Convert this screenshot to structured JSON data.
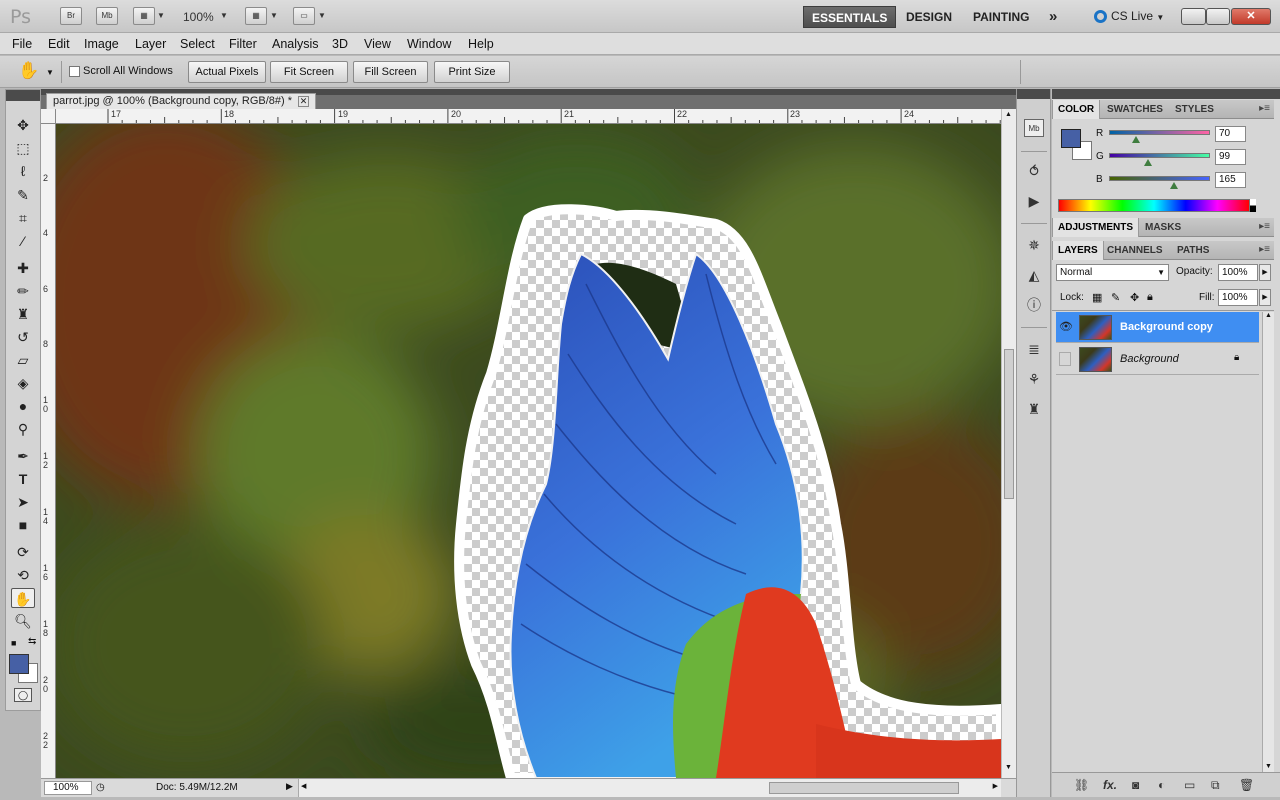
{
  "app": {
    "logo": "Ps",
    "launch_buttons": [
      "Br",
      "Mb"
    ],
    "zoom_level": "100%",
    "workspaces": [
      "ESSENTIALS",
      "DESIGN",
      "PAINTING"
    ],
    "active_workspace": "ESSENTIALS",
    "more_workspaces": "»",
    "cs_live": "CS Live"
  },
  "menu": [
    "File",
    "Edit",
    "Image",
    "Layer",
    "Select",
    "Filter",
    "Analysis",
    "3D",
    "View",
    "Window",
    "Help"
  ],
  "options": {
    "scroll_all_windows": "Scroll All Windows",
    "actual_pixels": "Actual Pixels",
    "fit_screen": "Fit Screen",
    "fill_screen": "Fill Screen",
    "print_size": "Print Size"
  },
  "document": {
    "tab_title": "parrot.jpg @ 100% (Background copy, RGB/8#) *",
    "ruler_top_numbers": [
      "17",
      "18",
      "19",
      "20",
      "21",
      "22",
      "23",
      "24"
    ],
    "ruler_left_numbers": [
      "2",
      "4",
      "6",
      "8",
      "1 0",
      "1 2",
      "1 4",
      "1 6",
      "1 8",
      "2 0",
      "2 2"
    ],
    "status_zoom": "100%",
    "doc_size": "Doc: 5.49M/12.2M"
  },
  "color_panel": {
    "tabs": [
      "COLOR",
      "SWATCHES",
      "STYLES"
    ],
    "active_tab": "COLOR",
    "foreground": "#4660a5",
    "background": "#ffffff",
    "channels": [
      {
        "label": "R",
        "value": "70"
      },
      {
        "label": "G",
        "value": "99"
      },
      {
        "label": "B",
        "value": "165"
      }
    ]
  },
  "adjustments_panel": {
    "tabs": [
      "ADJUSTMENTS",
      "MASKS"
    ],
    "active_tab": "ADJUSTMENTS"
  },
  "layers_panel": {
    "tabs": [
      "LAYERS",
      "CHANNELS",
      "PATHS"
    ],
    "active_tab": "LAYERS",
    "blend_mode": "Normal",
    "opacity_label": "Opacity:",
    "opacity": "100%",
    "lock_label": "Lock:",
    "fill_label": "Fill:",
    "fill": "100%",
    "layers": [
      {
        "name": "Background copy",
        "selected": true,
        "visible": true,
        "locked": false
      },
      {
        "name": "Background",
        "selected": false,
        "visible": false,
        "locked": true
      }
    ]
  },
  "tools": [
    "move-tool",
    "marquee-tool",
    "lasso-tool",
    "quick-selection-tool",
    "crop-tool",
    "eyedropper-tool",
    "spot-healing-tool",
    "brush-tool",
    "clone-stamp-tool",
    "history-brush-tool",
    "eraser-tool",
    "paint-bucket-tool",
    "blur-tool",
    "dodge-tool",
    "pen-tool",
    "type-tool",
    "path-selection-tool",
    "rectangle-tool",
    "3d-rotate-tool",
    "3d-orbit-tool",
    "hand-tool",
    "zoom-tool"
  ],
  "active_tool": "hand-tool"
}
